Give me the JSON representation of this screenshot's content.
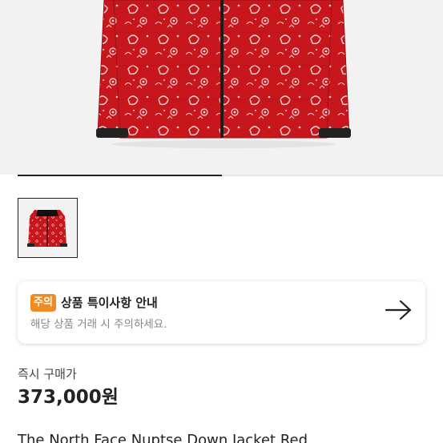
{
  "product": {
    "image_alt": "The North Face Nuptse Down Jacket Red paisley",
    "thumbnail_alt": "The North Face Nuptse Down Jacket Red thumbnail",
    "title": "The North Face Nuptse Down Jacket Red"
  },
  "carousel": {
    "progress_fraction": 0.48
  },
  "notice": {
    "badge": "주의",
    "title": "상품 특이사항 안내",
    "subtitle": "해당 상품 거래 시 주의하세요."
  },
  "price": {
    "label": "즉시 구매가",
    "value": "373,000원"
  },
  "colors": {
    "jacket_red": "#c8161d",
    "badge_orange": "#f08a24",
    "hero_bg": "#f2f2f2"
  }
}
